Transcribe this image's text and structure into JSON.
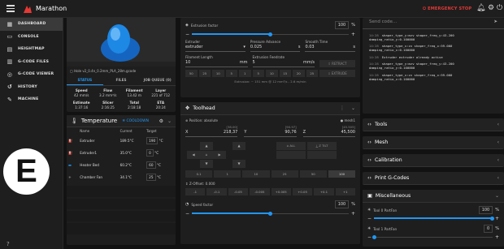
{
  "app": {
    "brand": "Marathon",
    "emergency_stop": "EMERGENCY STOP"
  },
  "sidebar": {
    "items": [
      {
        "label": "DASHBOARD",
        "icon": "dashboard-icon"
      },
      {
        "label": "CONSOLE",
        "icon": "console-icon"
      },
      {
        "label": "HEIGHTMAP",
        "icon": "heightmap-icon"
      },
      {
        "label": "G-CODE FILES",
        "icon": "files-icon"
      },
      {
        "label": "G-CODE VIEWER",
        "icon": "viewer-icon"
      },
      {
        "label": "HISTORY",
        "icon": "history-icon"
      },
      {
        "label": "MACHINE",
        "icon": "wrench-icon"
      }
    ]
  },
  "status_panel": {
    "filename": "Hole v2_0.4n_0.2mm_PLA_28m.gcode",
    "tabs": [
      "STATUS",
      "FILES",
      "JOB QUEUE (0)"
    ],
    "stats": [
      {
        "label": "Speed",
        "value": "42 mm/s"
      },
      {
        "label": "Flow",
        "value": "3.2 mm³/s"
      },
      {
        "label": "Filament",
        "value": "13.42 m"
      },
      {
        "label": "Layer",
        "value": "221 of 712"
      },
      {
        "label": "Estimate",
        "value": "1:37:16"
      },
      {
        "label": "Slicer",
        "value": "2:16:25"
      },
      {
        "label": "Total",
        "value": "2:18:18"
      },
      {
        "label": "ETA",
        "value": "20:24"
      }
    ]
  },
  "temperature": {
    "title": "Temperature",
    "cooldown": "COOLDOWN",
    "columns": [
      "Name",
      "Current",
      "Target"
    ],
    "rows": [
      {
        "name": "Extruder",
        "current": "189.5°C",
        "target": "190",
        "unit": "°C",
        "color": "#ff5252"
      },
      {
        "name": "Extruder1",
        "current": "35.0°C",
        "target": "0",
        "unit": "°C",
        "color": "#ff8a80"
      },
      {
        "name": "Heater Bed",
        "current": "60.2°C",
        "target": "60",
        "unit": "°C",
        "color": "#2196f3"
      },
      {
        "name": "Chamber Fan",
        "current": "34.1°C",
        "target": "25",
        "unit": "°C",
        "color": "#9e9e9e"
      }
    ]
  },
  "extruder_panel": {
    "extrusion_factor_label": "Extrusion factor",
    "extrusion_factor_value": "100",
    "extrusion_factor_unit": "%",
    "extrusion_factor_level": 0.5,
    "extruder_label": "Extruder",
    "extruder_value": "extruder",
    "pressure_label": "Pressure Advance",
    "pressure_value": "0.025",
    "pressure_unit": "s",
    "smooth_label": "Smooth Time",
    "smooth_value": "0.03",
    "smooth_unit": "s",
    "length_label": "Filament Length",
    "length_value": "10",
    "length_unit": "mm",
    "feedrate_label": "Extrusion Feedrate",
    "feedrate_value": "5",
    "feedrate_unit": "mm/s",
    "retract": "RETRACT",
    "extrude": "EXTRUDE",
    "steps": [
      "50",
      "25",
      "10",
      "5",
      "1",
      "5",
      "10",
      "15",
      "20",
      "25"
    ],
    "note": "Extrusion: ~ 151 mm @ 12 mm³/s - 2.6 m/min"
  },
  "toolhead": {
    "title": "Toolhead",
    "position_label": "Position: absolute",
    "mode": "mesh1",
    "axes": [
      {
        "axis": "X",
        "hint": "[38.00]",
        "value": "218,37"
      },
      {
        "axis": "Y",
        "hint": "[90.97]",
        "value": "90,76"
      },
      {
        "axis": "Z",
        "hint": "[45.505]",
        "value": "45,500"
      }
    ],
    "home_all": "ALL",
    "tilt": "Z TILT",
    "steps": [
      "0.1",
      "1",
      "10",
      "25",
      "50",
      "100"
    ],
    "z_offset_label": "Z-Offset: 0.000",
    "z_steps": [
      "-1",
      "-0.1",
      "-0.05",
      "-0.005",
      "+0.005",
      "+0.05",
      "+0.1",
      "+1"
    ],
    "speed_factor_label": "Speed factor",
    "speed_factor_value": "100",
    "speed_factor_unit": "%",
    "speed_factor_level": 0.5
  },
  "console": {
    "placeholder": "Send code...",
    "lines": [
      {
        "time": "14:28",
        "text": "shaper_type_y:mzv shaper_freq_y:43.200 damping_ratio_y:0.100000"
      },
      {
        "time": "14:28",
        "text": "shaper_type_x:zv shaper_freq_x:59.000 damping_ratio_x:0.100000"
      },
      {
        "time": "14:28",
        "text": "Extruder extruder already active"
      },
      {
        "time": "14:28",
        "text": "shaper_type_y:mzv shaper_freq_y:43.200 damping_ratio_y:0.100000"
      },
      {
        "time": "14:28",
        "text": "shaper_type_x:zv shaper_freq_x:59.000 damping_ratio_x:0.100000"
      }
    ]
  },
  "panels": [
    "Tools",
    "Mesh",
    "Calibration",
    "Print G-Codes"
  ],
  "misc": {
    "title": "Miscellaneous",
    "fans": [
      {
        "label": "Tool 0 PartFan",
        "value": "100",
        "unit": "%",
        "level": 1.0
      },
      {
        "label": "Tool 1 PartFan",
        "value": "0",
        "unit": "%",
        "level": 0.0
      }
    ]
  },
  "overlay": {
    "letter": "E"
  }
}
